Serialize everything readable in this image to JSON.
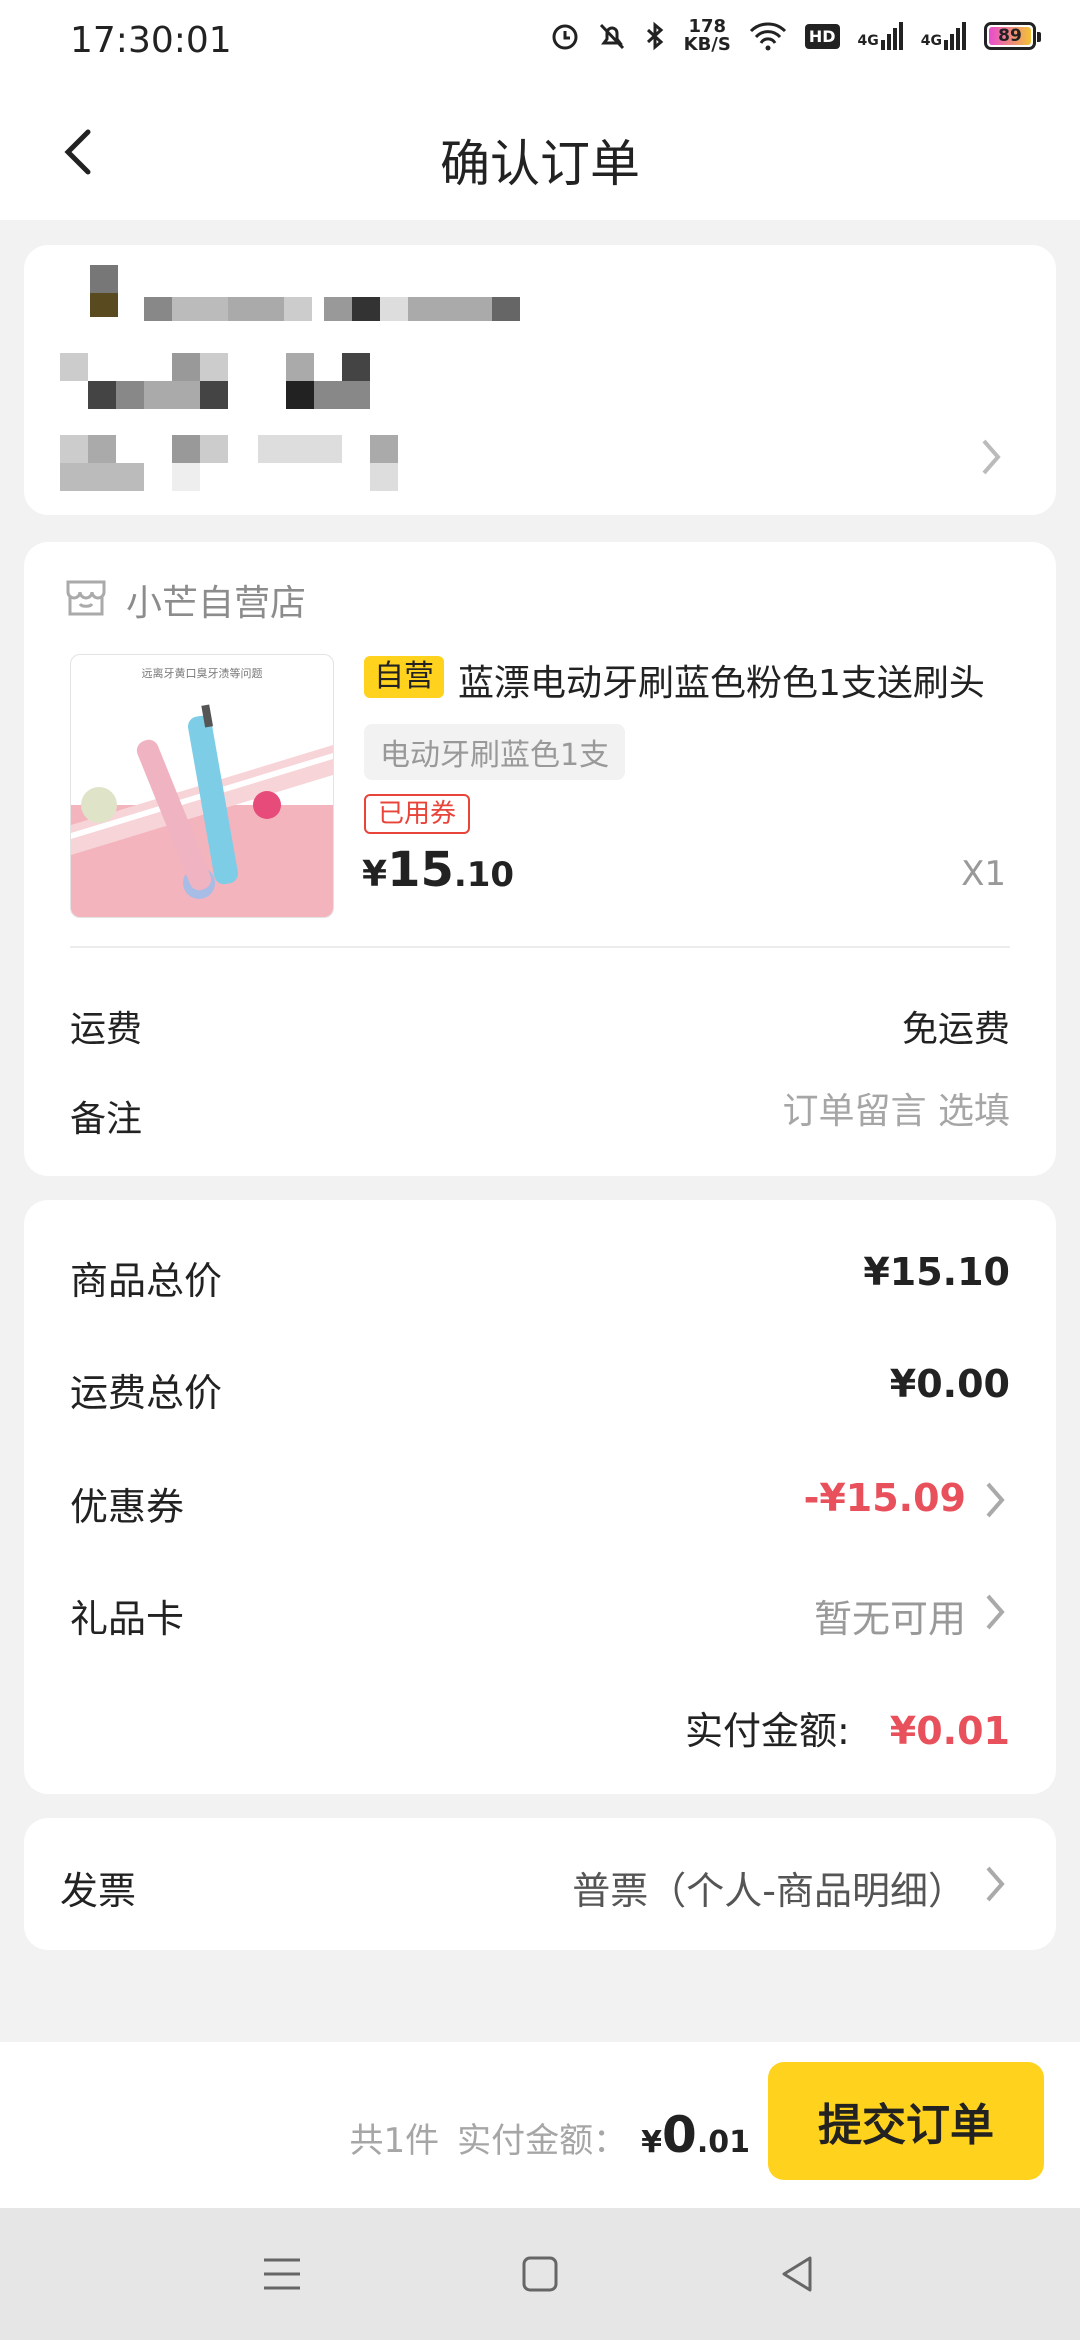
{
  "status_bar": {
    "time": "17:30:01",
    "net_speed_value": "178",
    "net_speed_unit": "KB/S",
    "hd_label": "HD",
    "network_label_1": "4G",
    "network_label_2": "4G",
    "battery": "89"
  },
  "header": {
    "title": "确认订单"
  },
  "store": {
    "name": "小芒自营店",
    "product": {
      "image_caption": "远离牙黄口臭牙渍等问题",
      "tag": "自营",
      "title": "蓝漂电动牙刷蓝色粉色1支送刷头",
      "variant": "电动牙刷蓝色1支",
      "coupon_tag": "已用券",
      "price_symbol": "¥",
      "price_int": "15",
      "price_dec": ".10",
      "quantity": "X1"
    },
    "shipping_label": "运费",
    "shipping_value": "免运费",
    "remark_label": "备注",
    "remark_placeholder": "订单留言 选填"
  },
  "summary": {
    "goods_total_label": "商品总价",
    "goods_total_value": "¥15.10",
    "shipping_total_label": "运费总价",
    "shipping_total_value": "¥0.00",
    "coupon_label": "优惠券",
    "coupon_value": "-¥15.09",
    "giftcard_label": "礼品卡",
    "giftcard_value": "暂无可用",
    "paid_label": "实付金额:",
    "paid_value": "¥0.01"
  },
  "invoice": {
    "label": "发票",
    "value": "普票（个人-商品明细）"
  },
  "bottom_bar": {
    "count_text": "共1件",
    "paid_label": "实付金额：",
    "price_symbol": "¥",
    "price_int": "0",
    "price_dec": ".01",
    "submit_label": "提交订单"
  },
  "colors": {
    "accent_yellow": "#ffd21e",
    "price_red": "#e8505b",
    "coupon_red": "#e8443a"
  }
}
